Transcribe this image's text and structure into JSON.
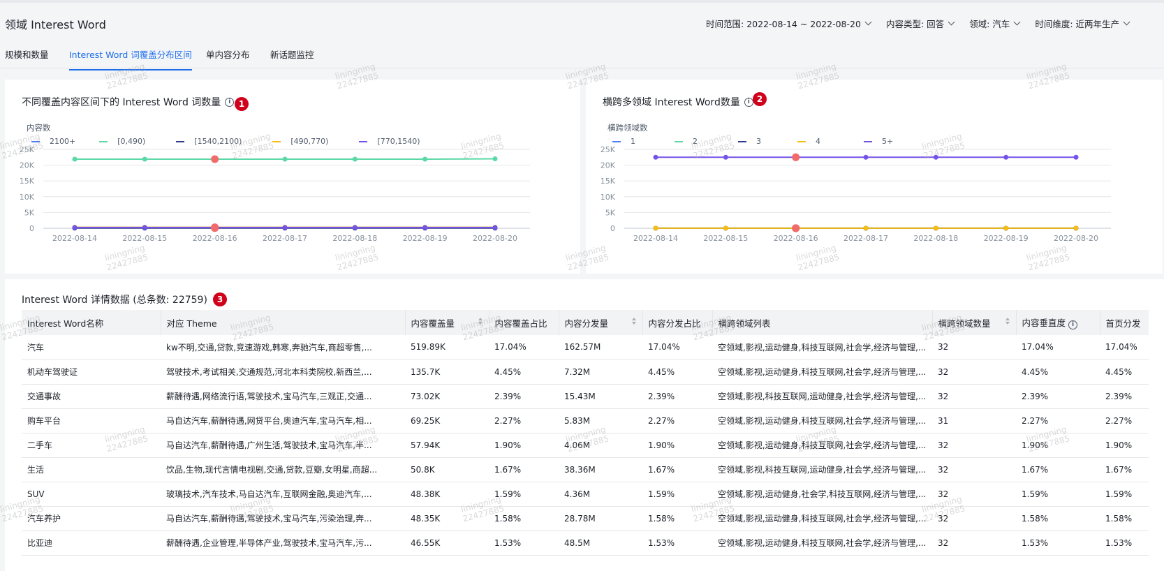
{
  "page": {
    "title": "领域 Interest Word"
  },
  "filters": [
    {
      "label": "时间范围: 2022-08-14 ~ 2022-08-20"
    },
    {
      "label": "内容类型: 回答"
    },
    {
      "label": "领域: 汽车"
    },
    {
      "label": "时间维度: 近两年生产"
    }
  ],
  "tabs": [
    {
      "label": "规模和数量",
      "active": false
    },
    {
      "label": "Interest Word 词覆盖分布区间",
      "active": true
    },
    {
      "label": "单内容分布",
      "active": false
    },
    {
      "label": "新话题监控",
      "active": false
    }
  ],
  "watermark": {
    "line1": "liningning",
    "line2": "22427885"
  },
  "chart1": {
    "title": "不同覆盖内容区间下的 Interest Word 词数量",
    "badge": "1",
    "legend_title": "内容数"
  },
  "chart2": {
    "title": "横跨多领域 Interest Word数量",
    "badge": "2",
    "legend_title": "横跨领域数"
  },
  "chart_data": [
    {
      "type": "line",
      "title": "不同覆盖内容区间下的 Interest Word 词数量",
      "legend_title": "内容数",
      "x": [
        "2022-08-14",
        "2022-08-15",
        "2022-08-16",
        "2022-08-17",
        "2022-08-18",
        "2022-08-19",
        "2022-08-20"
      ],
      "yticks": [
        "0",
        "5K",
        "10K",
        "15K",
        "20K",
        "25K"
      ],
      "ylim": [
        0,
        25000
      ],
      "grid": true,
      "legend_position": "top-left",
      "highlight_index": 2,
      "series": [
        {
          "name": "2100+",
          "color": "#4e7cf2",
          "values": [
            150,
            150,
            150,
            150,
            150,
            150,
            150
          ]
        },
        {
          "name": "[0,490)",
          "color": "#5ad8a6",
          "values": [
            21900,
            21900,
            21900,
            21900,
            21900,
            21900,
            22000
          ]
        },
        {
          "name": "[1540,2100)",
          "color": "#2f3a8c",
          "values": [
            60,
            60,
            60,
            60,
            60,
            60,
            60
          ]
        },
        {
          "name": "[490,770)",
          "color": "#f6bd16",
          "values": [
            300,
            300,
            300,
            300,
            300,
            300,
            300
          ]
        },
        {
          "name": "[770,1540)",
          "color": "#7453e8",
          "values": [
            250,
            250,
            250,
            250,
            250,
            250,
            250
          ]
        }
      ]
    },
    {
      "type": "line",
      "title": "横跨多领域 Interest Word数量",
      "legend_title": "横跨领域数",
      "x": [
        "2022-08-14",
        "2022-08-15",
        "2022-08-16",
        "2022-08-17",
        "2022-08-18",
        "2022-08-19",
        "2022-08-20"
      ],
      "yticks": [
        "0",
        "5K",
        "10K",
        "15K",
        "20K",
        "25K"
      ],
      "ylim": [
        0,
        25000
      ],
      "grid": true,
      "legend_position": "top-left",
      "highlight_index": 2,
      "series": [
        {
          "name": "1",
          "color": "#4e7cf2",
          "values": [
            10,
            10,
            10,
            10,
            10,
            10,
            10
          ]
        },
        {
          "name": "2",
          "color": "#5ad8a6",
          "values": [
            20,
            20,
            20,
            20,
            20,
            20,
            20
          ]
        },
        {
          "name": "3",
          "color": "#2f3a8c",
          "values": [
            15,
            15,
            15,
            15,
            15,
            15,
            15
          ]
        },
        {
          "name": "4",
          "color": "#f6bd16",
          "values": [
            30,
            30,
            30,
            30,
            30,
            30,
            30
          ]
        },
        {
          "name": "5+",
          "color": "#7453e8",
          "values": [
            22500,
            22500,
            22500,
            22500,
            22500,
            22500,
            22500
          ]
        }
      ]
    }
  ],
  "table": {
    "title": "Interest Word 详情数据 (总条数: 22759)",
    "badge": "3",
    "columns": [
      {
        "label": "Interest Word名称",
        "sortable": false,
        "info": false
      },
      {
        "label": "对应 Theme",
        "sortable": false,
        "info": false
      },
      {
        "label": "内容覆盖量",
        "sortable": true,
        "info": false
      },
      {
        "label": "内容覆盖占比",
        "sortable": false,
        "info": false
      },
      {
        "label": "内容分发量",
        "sortable": true,
        "info": false
      },
      {
        "label": "内容分发占比",
        "sortable": false,
        "info": false
      },
      {
        "label": "横跨领域列表",
        "sortable": false,
        "info": false
      },
      {
        "label": "横跨领域数量",
        "sortable": true,
        "info": false
      },
      {
        "label": "内容垂直度",
        "sortable": false,
        "info": true
      },
      {
        "label": "首页分发",
        "sortable": false,
        "info": false
      }
    ],
    "rows": [
      [
        "汽车",
        "kw不明,交通,贷款,竞速游戏,韩寒,奔驰汽车,商超零售,...",
        "519.89K",
        "17.04%",
        "162.57M",
        "17.04%",
        "空领域,影视,运动健身,科技互联网,社会学,经济与管理,...",
        "32",
        "17.04%",
        "17.04%"
      ],
      [
        "机动车驾驶证",
        "驾驶技术,考试相关,交通规范,河北本科类院校,新西兰,...",
        "135.7K",
        "4.45%",
        "7.32M",
        "4.45%",
        "空领域,影视,运动健身,科技互联网,社会学,经济与管理,...",
        "32",
        "4.45%",
        "4.45%"
      ],
      [
        "交通事故",
        "薪酬待遇,网络流行语,驾驶技术,宝马汽车,三观正,交通...",
        "73.02K",
        "2.39%",
        "15.43M",
        "2.39%",
        "空领域,影视,科技互联网,运动健身,社会学,经济与管理,...",
        "32",
        "2.39%",
        "2.39%"
      ],
      [
        "购车平台",
        "马自达汽车,薪酬待遇,网贷平台,奥迪汽车,宝马汽车,相...",
        "69.25K",
        "2.27%",
        "5.83M",
        "2.27%",
        "空领域,影视,运动健身,科技互联网,社会学,经济与管理,...",
        "31",
        "2.27%",
        "2.27%"
      ],
      [
        "二手车",
        "马自达汽车,薪酬待遇,广州生活,驾驶技术,宝马汽车,半...",
        "57.94K",
        "1.90%",
        "4.06M",
        "1.90%",
        "空领域,影视,运动健身,科技互联网,社会学,经济与管理,...",
        "32",
        "1.90%",
        "1.90%"
      ],
      [
        "生活",
        "饮品,生物,现代言情电视剧,交通,贷款,豆瓣,女明星,商超...",
        "50.8K",
        "1.67%",
        "38.36M",
        "1.67%",
        "空领域,影视,科技互联网,运动健身,社会学,经济与管理,...",
        "32",
        "1.67%",
        "1.67%"
      ],
      [
        "SUV",
        "玻璃技术,汽车技术,马自达汽车,互联网金融,奥迪汽车,...",
        "48.38K",
        "1.59%",
        "4.36M",
        "1.59%",
        "空领域,影视,运动健身,社会学,科技互联网,经济与管理,...",
        "32",
        "1.59%",
        "1.59%"
      ],
      [
        "汽车养护",
        "马自达汽车,薪酬待遇,驾驶技术,宝马汽车,污染治理,奔...",
        "48.35K",
        "1.58%",
        "28.78M",
        "1.58%",
        "空领域,影视,运动健身,科技互联网,社会学,经济与管理,...",
        "32",
        "1.58%",
        "1.58%"
      ],
      [
        "比亚迪",
        "薪酬待遇,企业管理,半导体产业,驾驶技术,宝马汽车,污...",
        "46.55K",
        "1.53%",
        "48.5M",
        "1.53%",
        "空领域,影视,运动健身,科技互联网,社会学,经济与管理,...",
        "32",
        "1.53%",
        "1.53%"
      ]
    ]
  }
}
